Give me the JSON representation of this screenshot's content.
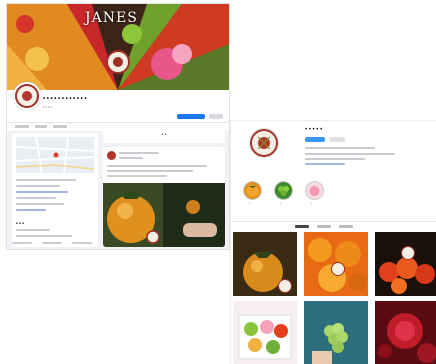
{
  "facebook": {
    "cover_title": "JANES",
    "page_name": "• • • • • • • • • • • •",
    "page_subtitle": "• • • •",
    "post_button_label": "• •",
    "intro_title": "• • •",
    "colors": {
      "brand_blue": "#1877f2",
      "seal_red": "#b2362a",
      "fruit_orange": "#e08a1e"
    }
  },
  "instagram": {
    "username": "• • • • •",
    "highlights": [
      {
        "icon": "persimmon-icon",
        "label": "•"
      },
      {
        "icon": "grape-icon",
        "label": "•"
      },
      {
        "icon": "peach-icon",
        "label": "•"
      }
    ],
    "grid": [
      {
        "icon": "persimmon-photo"
      },
      {
        "icon": "orange-photo"
      },
      {
        "icon": "tomato-photo"
      },
      {
        "icon": "grapes-box-photo"
      },
      {
        "icon": "green-grapes-photo"
      },
      {
        "icon": "pomegranate-photo"
      }
    ]
  }
}
